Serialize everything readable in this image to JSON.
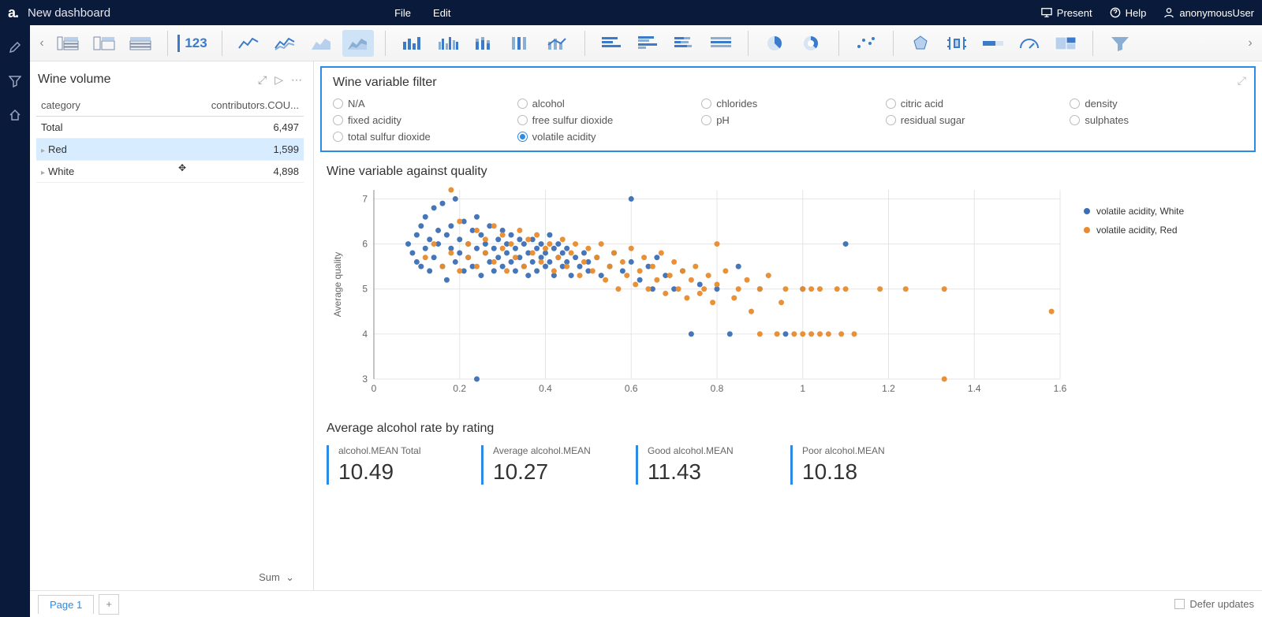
{
  "header": {
    "title": "New dashboard",
    "menu": [
      "File",
      "Edit"
    ],
    "present": "Present",
    "help": "Help",
    "user": "anonymousUser",
    "logo": "a."
  },
  "ribbon": {
    "num": "123"
  },
  "panel_left": {
    "title": "Wine volume",
    "col1": "category",
    "col2": "contributors.COU...",
    "rows": [
      {
        "cat": "Total",
        "val": "6,497",
        "expand": false
      },
      {
        "cat": "Red",
        "val": "1,599",
        "expand": true,
        "hover": true
      },
      {
        "cat": "White",
        "val": "4,898",
        "expand": true
      }
    ],
    "sum": "Sum"
  },
  "filter": {
    "title": "Wine variable filter",
    "options": [
      {
        "l": "N/A"
      },
      {
        "l": "alcohol"
      },
      {
        "l": "chlorides"
      },
      {
        "l": "citric acid"
      },
      {
        "l": "density"
      },
      {
        "l": "fixed acidity"
      },
      {
        "l": "free sulfur dioxide"
      },
      {
        "l": "pH"
      },
      {
        "l": "residual sugar"
      },
      {
        "l": "sulphates"
      },
      {
        "l": "total sulfur dioxide"
      },
      {
        "l": "volatile acidity",
        "sel": true
      }
    ]
  },
  "scatter": {
    "title": "Wine variable against quality",
    "ylabel": "Average quality",
    "legend": [
      {
        "l": "volatile acidity, White",
        "c": "#3b6fb5"
      },
      {
        "l": "volatile acidity, Red",
        "c": "#e88b2d"
      }
    ]
  },
  "kpi": {
    "title": "Average alcohol rate by rating",
    "items": [
      {
        "l": "alcohol.MEAN Total",
        "v": "10.49"
      },
      {
        "l": "Average alcohol.MEAN",
        "v": "10.27"
      },
      {
        "l": "Good alcohol.MEAN",
        "v": "11.43"
      },
      {
        "l": "Poor alcohol.MEAN",
        "v": "10.18"
      }
    ]
  },
  "footer": {
    "page": "Page 1",
    "defer": "Defer updates"
  },
  "chart_data": {
    "type": "scatter",
    "xlabel": "",
    "ylabel": "Average quality",
    "xlim": [
      0,
      1.6
    ],
    "ylim": [
      3,
      7.2
    ],
    "xticks": [
      0,
      0.2,
      0.4,
      0.6,
      0.8,
      1,
      1.2,
      1.4,
      1.6
    ],
    "yticks": [
      3,
      4,
      5,
      6,
      7
    ],
    "series": [
      {
        "name": "volatile acidity, White",
        "color": "#3b6fb5",
        "points": [
          [
            0.08,
            6.0
          ],
          [
            0.09,
            5.8
          ],
          [
            0.1,
            5.6
          ],
          [
            0.1,
            6.2
          ],
          [
            0.11,
            6.4
          ],
          [
            0.11,
            5.5
          ],
          [
            0.12,
            6.6
          ],
          [
            0.12,
            5.9
          ],
          [
            0.13,
            6.1
          ],
          [
            0.13,
            5.4
          ],
          [
            0.14,
            6.8
          ],
          [
            0.14,
            5.7
          ],
          [
            0.15,
            6.0
          ],
          [
            0.15,
            6.3
          ],
          [
            0.16,
            5.5
          ],
          [
            0.16,
            6.9
          ],
          [
            0.17,
            6.2
          ],
          [
            0.17,
            5.2
          ],
          [
            0.18,
            5.9
          ],
          [
            0.18,
            6.4
          ],
          [
            0.19,
            7.0
          ],
          [
            0.19,
            5.6
          ],
          [
            0.2,
            6.1
          ],
          [
            0.2,
            5.8
          ],
          [
            0.21,
            5.4
          ],
          [
            0.21,
            6.5
          ],
          [
            0.22,
            6.0
          ],
          [
            0.22,
            5.7
          ],
          [
            0.23,
            6.3
          ],
          [
            0.23,
            5.5
          ],
          [
            0.24,
            6.6
          ],
          [
            0.24,
            5.9
          ],
          [
            0.25,
            5.3
          ],
          [
            0.25,
            6.2
          ],
          [
            0.26,
            5.8
          ],
          [
            0.26,
            6.0
          ],
          [
            0.27,
            5.6
          ],
          [
            0.27,
            6.4
          ],
          [
            0.28,
            5.9
          ],
          [
            0.28,
            5.4
          ],
          [
            0.29,
            6.1
          ],
          [
            0.29,
            5.7
          ],
          [
            0.3,
            6.3
          ],
          [
            0.3,
            5.5
          ],
          [
            0.31,
            5.8
          ],
          [
            0.31,
            6.0
          ],
          [
            0.32,
            5.6
          ],
          [
            0.32,
            6.2
          ],
          [
            0.33,
            5.4
          ],
          [
            0.33,
            5.9
          ],
          [
            0.34,
            6.1
          ],
          [
            0.34,
            5.7
          ],
          [
            0.35,
            5.5
          ],
          [
            0.35,
            6.0
          ],
          [
            0.36,
            5.8
          ],
          [
            0.36,
            5.3
          ],
          [
            0.37,
            6.1
          ],
          [
            0.37,
            5.6
          ],
          [
            0.38,
            5.9
          ],
          [
            0.38,
            5.4
          ],
          [
            0.39,
            6.0
          ],
          [
            0.39,
            5.7
          ],
          [
            0.4,
            5.5
          ],
          [
            0.4,
            5.8
          ],
          [
            0.41,
            6.2
          ],
          [
            0.41,
            5.6
          ],
          [
            0.42,
            5.9
          ],
          [
            0.42,
            5.3
          ],
          [
            0.43,
            5.7
          ],
          [
            0.43,
            6.0
          ],
          [
            0.44,
            5.5
          ],
          [
            0.44,
            5.8
          ],
          [
            0.45,
            5.6
          ],
          [
            0.45,
            5.9
          ],
          [
            0.46,
            5.3
          ],
          [
            0.47,
            5.7
          ],
          [
            0.48,
            5.5
          ],
          [
            0.49,
            5.8
          ],
          [
            0.5,
            5.4
          ],
          [
            0.5,
            5.6
          ],
          [
            0.52,
            5.7
          ],
          [
            0.53,
            5.3
          ],
          [
            0.55,
            5.5
          ],
          [
            0.56,
            5.8
          ],
          [
            0.58,
            5.4
          ],
          [
            0.6,
            5.6
          ],
          [
            0.6,
            7.0
          ],
          [
            0.62,
            5.2
          ],
          [
            0.64,
            5.5
          ],
          [
            0.65,
            5.0
          ],
          [
            0.66,
            5.7
          ],
          [
            0.68,
            5.3
          ],
          [
            0.7,
            5.0
          ],
          [
            0.72,
            5.4
          ],
          [
            0.74,
            4.0
          ],
          [
            0.76,
            5.1
          ],
          [
            0.8,
            5.0
          ],
          [
            0.83,
            4.0
          ],
          [
            0.85,
            5.5
          ],
          [
            0.9,
            5.0
          ],
          [
            0.96,
            4.0
          ],
          [
            1.0,
            5.0
          ],
          [
            1.1,
            6.0
          ],
          [
            0.24,
            3.0
          ]
        ]
      },
      {
        "name": "volatile acidity, Red",
        "color": "#e88b2d",
        "points": [
          [
            0.12,
            5.7
          ],
          [
            0.14,
            6.0
          ],
          [
            0.16,
            5.5
          ],
          [
            0.18,
            5.8
          ],
          [
            0.18,
            7.2
          ],
          [
            0.2,
            6.5
          ],
          [
            0.2,
            5.4
          ],
          [
            0.22,
            6.0
          ],
          [
            0.22,
            5.7
          ],
          [
            0.24,
            6.3
          ],
          [
            0.24,
            5.5
          ],
          [
            0.26,
            6.1
          ],
          [
            0.26,
            5.8
          ],
          [
            0.28,
            5.6
          ],
          [
            0.28,
            6.4
          ],
          [
            0.3,
            5.9
          ],
          [
            0.3,
            6.2
          ],
          [
            0.31,
            5.4
          ],
          [
            0.32,
            6.0
          ],
          [
            0.33,
            5.7
          ],
          [
            0.34,
            6.3
          ],
          [
            0.35,
            5.5
          ],
          [
            0.36,
            6.1
          ],
          [
            0.37,
            5.8
          ],
          [
            0.38,
            6.2
          ],
          [
            0.39,
            5.6
          ],
          [
            0.4,
            5.9
          ],
          [
            0.41,
            6.0
          ],
          [
            0.42,
            5.4
          ],
          [
            0.43,
            5.7
          ],
          [
            0.44,
            6.1
          ],
          [
            0.45,
            5.5
          ],
          [
            0.46,
            5.8
          ],
          [
            0.47,
            6.0
          ],
          [
            0.48,
            5.3
          ],
          [
            0.49,
            5.6
          ],
          [
            0.5,
            5.9
          ],
          [
            0.51,
            5.4
          ],
          [
            0.52,
            5.7
          ],
          [
            0.53,
            6.0
          ],
          [
            0.54,
            5.2
          ],
          [
            0.55,
            5.5
          ],
          [
            0.56,
            5.8
          ],
          [
            0.57,
            5.0
          ],
          [
            0.58,
            5.6
          ],
          [
            0.59,
            5.3
          ],
          [
            0.6,
            5.9
          ],
          [
            0.61,
            5.1
          ],
          [
            0.62,
            5.4
          ],
          [
            0.63,
            5.7
          ],
          [
            0.64,
            5.0
          ],
          [
            0.65,
            5.5
          ],
          [
            0.66,
            5.2
          ],
          [
            0.67,
            5.8
          ],
          [
            0.68,
            4.9
          ],
          [
            0.69,
            5.3
          ],
          [
            0.7,
            5.6
          ],
          [
            0.71,
            5.0
          ],
          [
            0.72,
            5.4
          ],
          [
            0.73,
            4.8
          ],
          [
            0.74,
            5.2
          ],
          [
            0.75,
            5.5
          ],
          [
            0.76,
            4.9
          ],
          [
            0.77,
            5.0
          ],
          [
            0.78,
            5.3
          ],
          [
            0.79,
            4.7
          ],
          [
            0.8,
            5.1
          ],
          [
            0.8,
            6.0
          ],
          [
            0.82,
            5.4
          ],
          [
            0.84,
            4.8
          ],
          [
            0.85,
            5.0
          ],
          [
            0.87,
            5.2
          ],
          [
            0.88,
            4.5
          ],
          [
            0.9,
            5.0
          ],
          [
            0.9,
            4.0
          ],
          [
            0.92,
            5.3
          ],
          [
            0.94,
            4.0
          ],
          [
            0.95,
            4.7
          ],
          [
            0.96,
            5.0
          ],
          [
            0.98,
            4.0
          ],
          [
            1.0,
            5.0
          ],
          [
            1.0,
            4.0
          ],
          [
            1.02,
            5.0
          ],
          [
            1.02,
            4.0
          ],
          [
            1.04,
            4.0
          ],
          [
            1.04,
            5.0
          ],
          [
            1.06,
            4.0
          ],
          [
            1.08,
            5.0
          ],
          [
            1.09,
            4.0
          ],
          [
            1.1,
            5.0
          ],
          [
            1.12,
            4.0
          ],
          [
            1.18,
            5.0
          ],
          [
            1.24,
            5.0
          ],
          [
            1.33,
            5.0
          ],
          [
            1.33,
            3.0
          ],
          [
            1.58,
            4.5
          ]
        ]
      }
    ]
  }
}
